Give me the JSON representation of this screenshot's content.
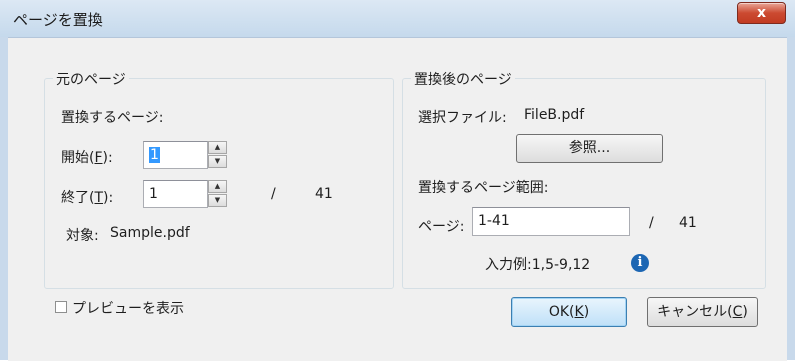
{
  "window": {
    "title": "ページを置換",
    "close_glyph": "x"
  },
  "source": {
    "legend": "元のページ",
    "pages_heading": "置換するページ:",
    "start_label_prefix": "開始(",
    "start_label_key": "F",
    "start_label_suffix": "):",
    "start_value": "1",
    "end_label_prefix": "終了(",
    "end_label_key": "T",
    "end_label_suffix": "):",
    "end_value": "1",
    "separator": "/",
    "total_pages": "41",
    "target_label": "対象:",
    "target_file": "Sample.pdf"
  },
  "replacement": {
    "legend": "置換後のページ",
    "file_label": "選択ファイル:",
    "file_name": "FileB.pdf",
    "browse_label": "参照...",
    "range_heading": "置換するページ範囲:",
    "page_label": "ページ:",
    "page_value": "1-41",
    "separator": "/",
    "total_pages": "41",
    "example_text": "入力例:1,5-9,12",
    "info_glyph": "i"
  },
  "preview": {
    "label": "プレビューを表示",
    "checked": false
  },
  "buttons": {
    "ok_prefix": "OK(",
    "ok_key": "K",
    "ok_suffix": ")",
    "cancel_prefix": "キャンセル(",
    "cancel_key": "C",
    "cancel_suffix": ")"
  },
  "colors": {
    "selection": "#3399ff",
    "close_button": "#c23b22",
    "info_icon": "#1c66b3"
  }
}
